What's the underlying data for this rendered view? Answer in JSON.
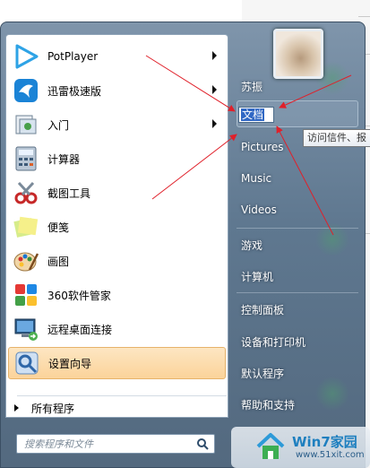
{
  "start_menu": {
    "programs": [
      {
        "label": "PotPlayer",
        "icon": "potplayer-icon",
        "has_submenu": true
      },
      {
        "label": "迅雷极速版",
        "icon": "xunlei-icon",
        "has_submenu": true
      },
      {
        "label": "入门",
        "icon": "getting-started-icon",
        "has_submenu": true
      },
      {
        "label": "计算器",
        "icon": "calculator-icon",
        "has_submenu": false
      },
      {
        "label": "截图工具",
        "icon": "snipping-tool-icon",
        "has_submenu": false
      },
      {
        "label": "便笺",
        "icon": "sticky-notes-icon",
        "has_submenu": false
      },
      {
        "label": "画图",
        "icon": "paint-icon",
        "has_submenu": false
      },
      {
        "label": "360软件管家",
        "icon": "360-manager-icon",
        "has_submenu": false
      },
      {
        "label": "远程桌面连接",
        "icon": "remote-desktop-icon",
        "has_submenu": false
      },
      {
        "label": "设置向导",
        "icon": "setup-wizard-icon",
        "has_submenu": false,
        "selected": true
      }
    ],
    "all_programs_label": "所有程序",
    "search_placeholder": "搜索程序和文件",
    "right_items": {
      "user": "苏振",
      "documents_renaming": "文档",
      "documents_tooltip": "访问信件、报",
      "pictures": "Pictures",
      "music": "Music",
      "videos": "Videos",
      "games": "游戏",
      "computer": "计算机",
      "control_panel": "控制面板",
      "devices_printers": "设备和打印机",
      "default_programs": "默认程序",
      "help_support": "帮助和支持"
    }
  },
  "watermark": {
    "title": "Win7家园",
    "url": "www.51xit.com"
  },
  "colors": {
    "menu_top": "#7f95ab",
    "menu_bottom": "#53697f",
    "selection": "#fbd39a",
    "annotation_arrow": "#e0202a"
  }
}
